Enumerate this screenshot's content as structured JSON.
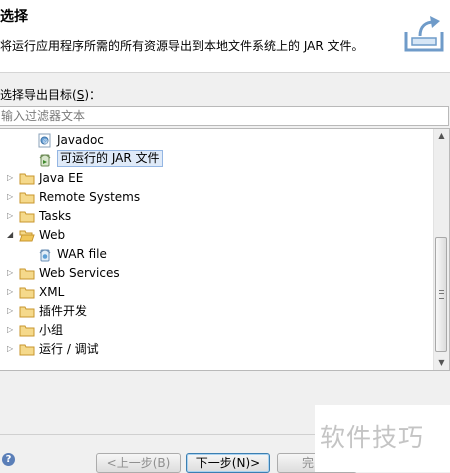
{
  "header": {
    "title": "选择",
    "description": "将运行应用程序所需的所有资源导出到本地文件系统上的 JAR 文件。",
    "graphic_icon": "export-wizard-icon"
  },
  "selection": {
    "label_prefix": "选择导出目标(",
    "label_mnemonic": "S",
    "label_suffix": ")："
  },
  "filter": {
    "placeholder": "输入过滤器文本",
    "value": ""
  },
  "tree": {
    "items": [
      {
        "label": "Javadoc",
        "icon": "javadoc-icon",
        "expanded": null,
        "selected": false
      },
      {
        "label": "可运行的 JAR 文件",
        "icon": "jar-file-icon",
        "expanded": null,
        "selected": true
      },
      {
        "label": "Java EE",
        "icon": "folder-icon",
        "expanded": false,
        "selected": false
      },
      {
        "label": "Remote Systems",
        "icon": "folder-icon",
        "expanded": false,
        "selected": false
      },
      {
        "label": "Tasks",
        "icon": "folder-icon",
        "expanded": false,
        "selected": false
      },
      {
        "label": "Web",
        "icon": "folder-icon",
        "expanded": true,
        "selected": false
      },
      {
        "label": "WAR file",
        "icon": "war-file-icon",
        "expanded": null,
        "selected": false
      },
      {
        "label": "Web Services",
        "icon": "folder-icon",
        "expanded": false,
        "selected": false
      },
      {
        "label": "XML",
        "icon": "folder-icon",
        "expanded": false,
        "selected": false
      },
      {
        "label": "插件开发",
        "icon": "folder-icon",
        "expanded": false,
        "selected": false
      },
      {
        "label": "小组",
        "icon": "folder-icon",
        "expanded": false,
        "selected": false
      },
      {
        "label": "运行 / 调试",
        "icon": "folder-icon",
        "expanded": false,
        "selected": false
      }
    ]
  },
  "buttons": {
    "help_icon": "help-icon",
    "back": "<上一步(B)",
    "next": "下一步(N)>",
    "finish": "完"
  },
  "watermark": "软件技巧",
  "colors": {
    "folder": "#e8b84a",
    "selection_bg": "#dfeaf8",
    "selection_border": "#94b6e3",
    "default_button_border": "#3c7fb1"
  }
}
